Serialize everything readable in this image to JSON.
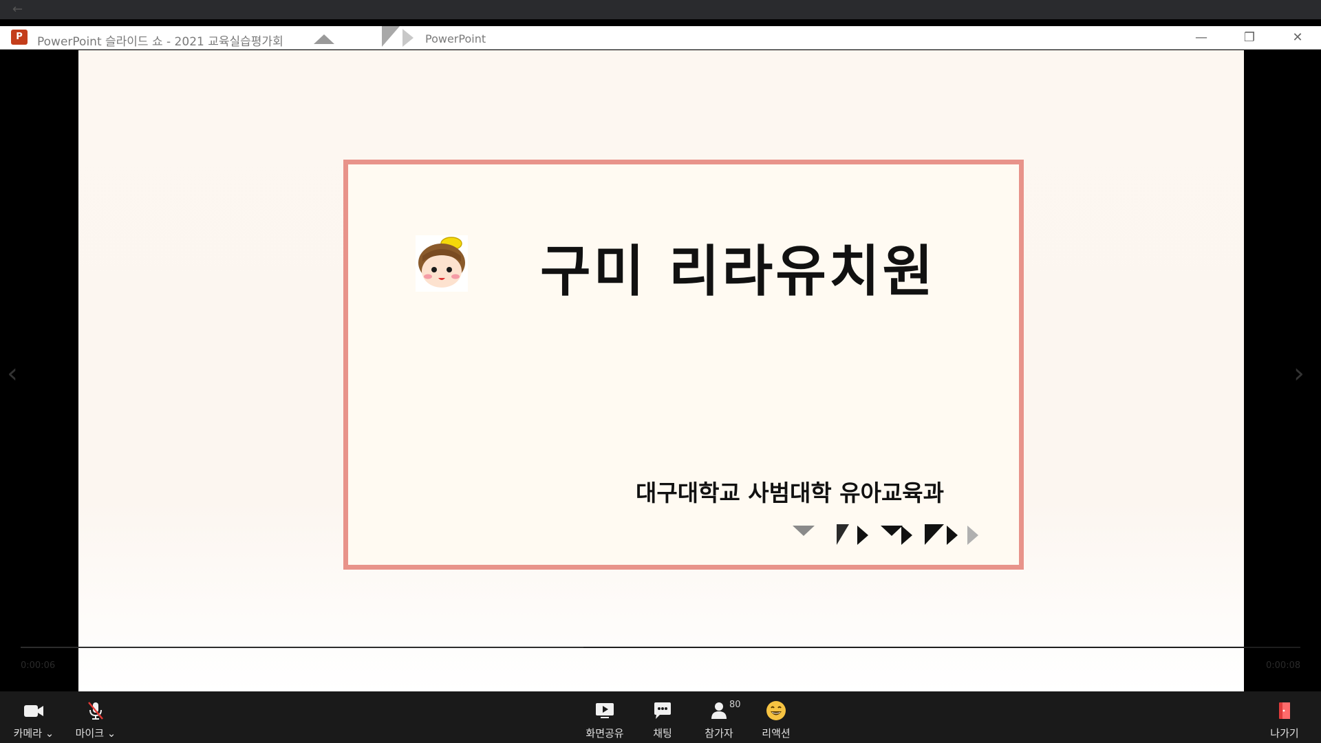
{
  "window": {
    "title": "PowerPoint 슬라이드 쇼  -  2021 교육실습평가회",
    "title2": "PowerPoint",
    "minimize": "—",
    "restore": "❐",
    "close": "✕"
  },
  "slide": {
    "title": "구미 리라유치원",
    "subtitle": "대구대학교 사범대학 유아교육과"
  },
  "playback": {
    "elapsed": "0:00:06",
    "remaining": "0:00:08",
    "progress": 0.44
  },
  "toolbar": {
    "camera_label": "카메라",
    "mic_label": "마이크",
    "share_label": "화면공유",
    "chat_label": "채팅",
    "participants_label": "참가자",
    "participants_count": "80",
    "reaction_label": "리액션",
    "leave_label": "나가기"
  },
  "colors": {
    "frame": "#e8938a",
    "toolbar": "#1a1a1a",
    "leave": "#e03b3b"
  }
}
